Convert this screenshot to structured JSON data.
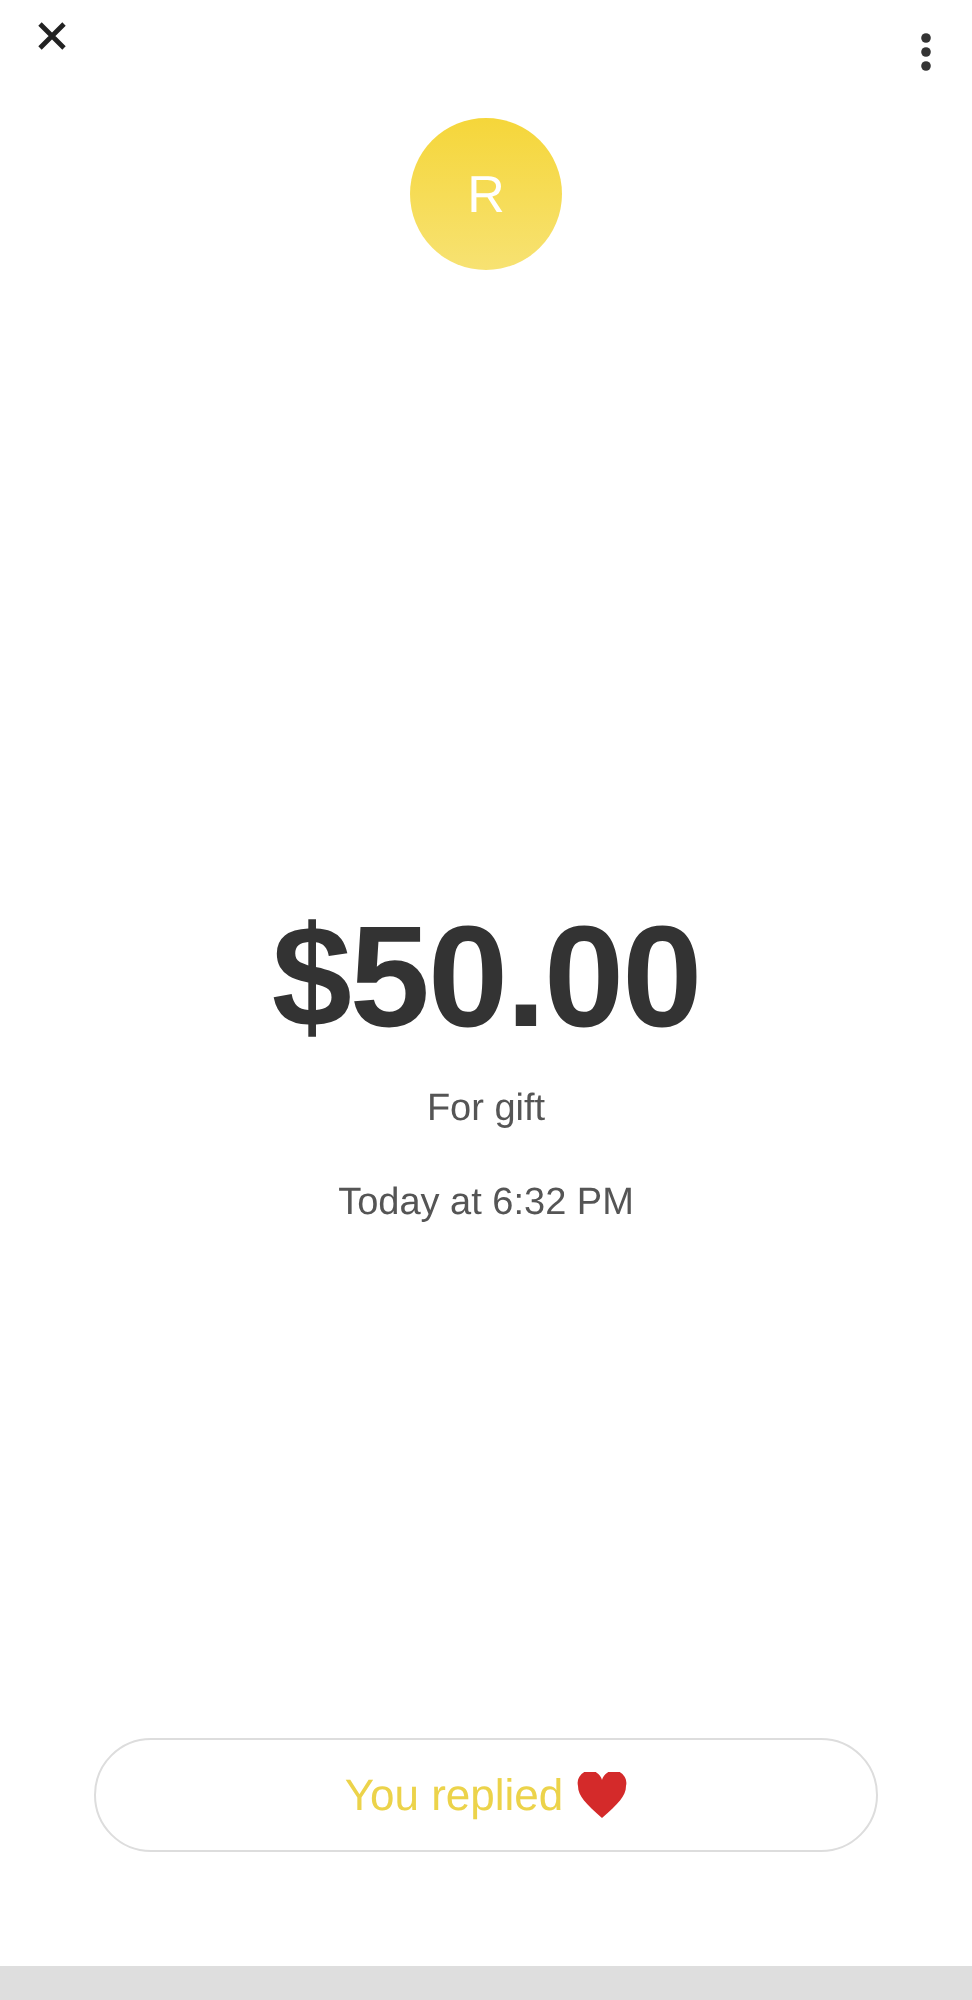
{
  "avatar": {
    "initial": "R"
  },
  "payment": {
    "amount": "$50.00",
    "note": "For gift",
    "time": "Today at 6:32 PM"
  },
  "reply_button": {
    "label": "You replied"
  }
}
